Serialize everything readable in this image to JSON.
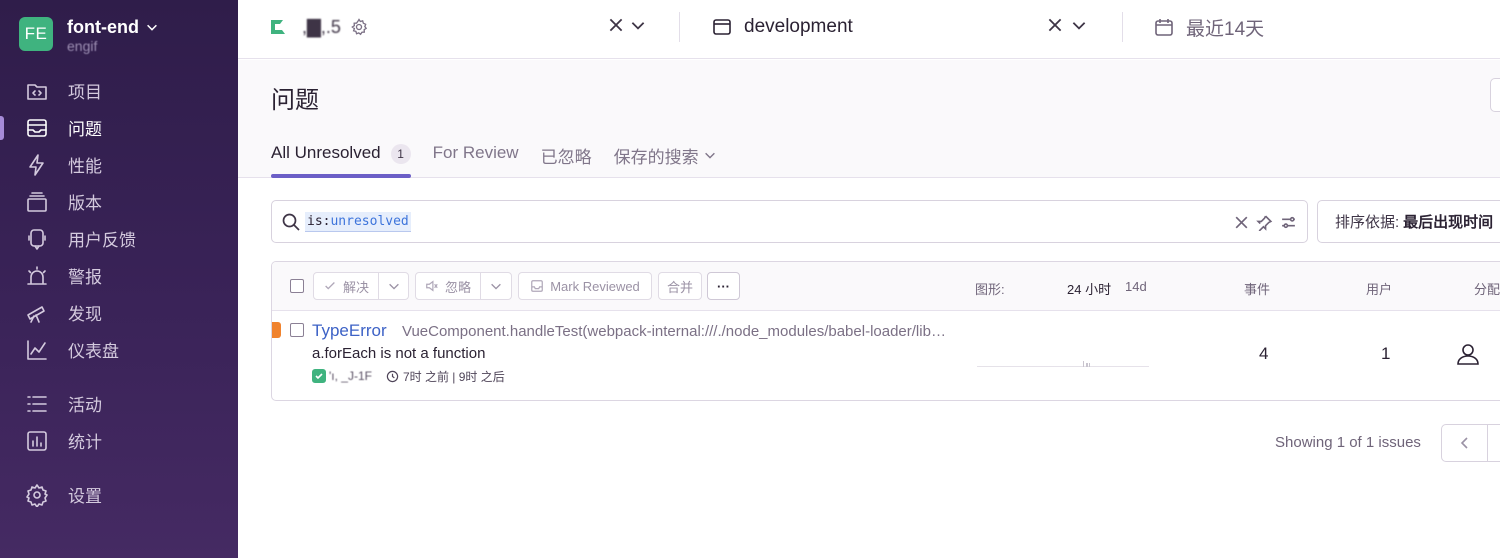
{
  "org": {
    "initials": "FE",
    "name": "font-end",
    "subtitle": "engif"
  },
  "sidebar": {
    "items": [
      {
        "key": "projects",
        "label": "项目"
      },
      {
        "key": "issues",
        "label": "问题"
      },
      {
        "key": "performance",
        "label": "性能"
      },
      {
        "key": "releases",
        "label": "版本"
      },
      {
        "key": "feedback",
        "label": "用户反馈"
      },
      {
        "key": "alerts",
        "label": "警报"
      },
      {
        "key": "discover",
        "label": "发现"
      },
      {
        "key": "dashboards",
        "label": "仪表盘"
      },
      {
        "key": "activity",
        "label": "活动"
      },
      {
        "key": "stats",
        "label": "统计"
      },
      {
        "key": "settings",
        "label": "设置"
      }
    ]
  },
  "topbar": {
    "project_name": ",▇,.5",
    "environment": "development",
    "date_range": "最近14天"
  },
  "page": {
    "title": "问题"
  },
  "tabs": [
    {
      "label": "All Unresolved",
      "badge": "1"
    },
    {
      "label": "For Review"
    },
    {
      "label": "已忽略"
    },
    {
      "label": "保存的搜索"
    }
  ],
  "search": {
    "token_key": "is:",
    "token_value": "unresolved"
  },
  "sort": {
    "label": "排序依据:",
    "value": "最后出现时间"
  },
  "toolbar": {
    "resolve": "解决",
    "ignore": "忽略",
    "mark_reviewed": "Mark Reviewed",
    "merge": "合并",
    "more": "···"
  },
  "columns": {
    "graph": "图形:",
    "period_24h": "24 小时",
    "period_14d": "14d",
    "events": "事件",
    "users": "用户",
    "assignee": "分配"
  },
  "issue": {
    "type": "TypeError",
    "location": "VueComponent.handleTest(webpack-internal:///./node_modules/babel-loader/lib/index.js)",
    "message": "a.forEach is not a function",
    "short_id": "'ı,  _J-1F",
    "age": "7时 之前 | 9时 之后",
    "events": "4",
    "users": "1",
    "trend": [
      0,
      0,
      0,
      0,
      0,
      0,
      0,
      0,
      0,
      0,
      0,
      0,
      0,
      0,
      0,
      0,
      0,
      0,
      0,
      0,
      0,
      0,
      0,
      0,
      0,
      0,
      0,
      0,
      0,
      0,
      0,
      0,
      0,
      0,
      0,
      0,
      0,
      0,
      0,
      0,
      0,
      0,
      0,
      0,
      0,
      0,
      0,
      0,
      0,
      0,
      0,
      0,
      0,
      0,
      0,
      0,
      0,
      0,
      0,
      0,
      0,
      0,
      0,
      0,
      0,
      0,
      0,
      0,
      0,
      0,
      0,
      0,
      0,
      0,
      0,
      0,
      0,
      0,
      0,
      0,
      0,
      0,
      0,
      0,
      0,
      0,
      0,
      0,
      0,
      0,
      0,
      0,
      0,
      0,
      0,
      0,
      0,
      0,
      0,
      0,
      0,
      0,
      0,
      0,
      0,
      2,
      0,
      0,
      1,
      1,
      0,
      1,
      0,
      0,
      0,
      0,
      0,
      0,
      0,
      0,
      0,
      0,
      0,
      0,
      0,
      0,
      0,
      0,
      0,
      0,
      0,
      0,
      0,
      0,
      0,
      0,
      0,
      0,
      0,
      0,
      0,
      0,
      0,
      0,
      0,
      0,
      0,
      0,
      0,
      0,
      0,
      0,
      0,
      0,
      0,
      0,
      0,
      0,
      0,
      0,
      0,
      0,
      0,
      0,
      0,
      0,
      0,
      0,
      0,
      0
    ]
  },
  "pagination": {
    "summary": "Showing 1 of 1 issues"
  },
  "colors": {
    "accent": "#6c5fc7",
    "link": "#3d62c6",
    "sidebar": "#3a2358",
    "level_error": "#f0832e",
    "success": "#3fb37f"
  }
}
